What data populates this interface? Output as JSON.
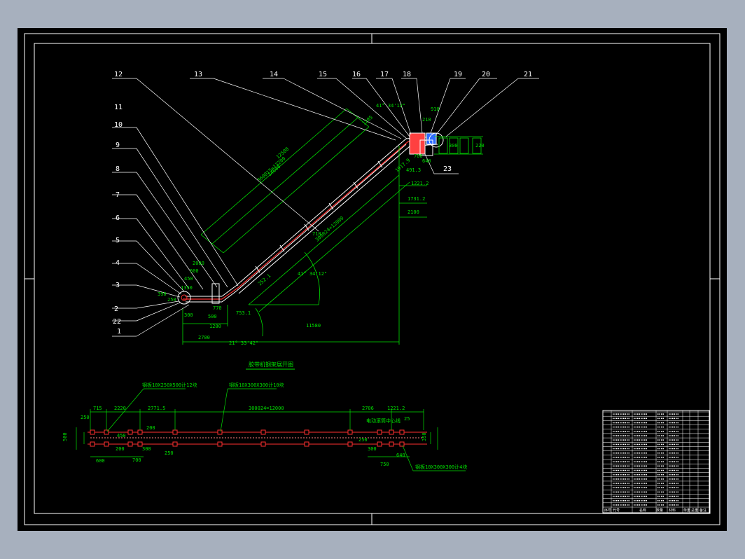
{
  "colors": {
    "background": "#a7b0be",
    "canvas": "#000000",
    "border": "#ffffff",
    "dimension": "#00e000",
    "leader": "#ffffff",
    "part": "#ff3030",
    "part_fill": "#ff4040",
    "blue": "#2f6cff"
  },
  "balloons": [
    "1",
    "2",
    "22",
    "3",
    "4",
    "5",
    "6",
    "7",
    "8",
    "9",
    "10",
    "11",
    "12",
    "13",
    "14",
    "15",
    "16",
    "17",
    "18",
    "19",
    "20",
    "21",
    "23"
  ],
  "elevation_dims": {
    "d2700": "2700",
    "d1280": "1280",
    "d300": "300",
    "d500": "500",
    "d770": "770",
    "d753": "753.1",
    "d11580": "11580",
    "d2100": "2100",
    "d1221": "1221.2",
    "d1731": "1731.2",
    "d491": "491.3",
    "d450": "450",
    "d600": "600",
    "d250": "250",
    "d390": "390",
    "d1350": "1350",
    "d2000": "2000",
    "d12500": "12500",
    "d300024": "300024=12000",
    "d360015": "360015=13200",
    "d710": "710",
    "d252": "252.1",
    "d1917": "1917.9",
    "d14600": "14600",
    "d1285": "1285",
    "angle_a": "41° 34'12\"",
    "angle_b": "21° 33'42\"",
    "angle_c": "41° 34'12\"",
    "d700": "700",
    "d640": "640",
    "d910": "910",
    "d210": "210",
    "d300b": "300",
    "d220": "220"
  },
  "plan_title": "胶带机钢架展开图",
  "plan_dims": {
    "p715": "715",
    "p2220": "2220",
    "p2771": "2771.5",
    "p300024": "300024=12000",
    "p2706": "2706",
    "p1221": "1221.2",
    "p250": "250",
    "p450": "450",
    "p200": "200",
    "p300": "300",
    "p200b": "200",
    "p700": "700",
    "p250b": "250",
    "p600": "600",
    "p500": "500",
    "p300b": "300",
    "p750": "750",
    "p640": "640",
    "p250c": "250",
    "p350": "350",
    "p25": "25"
  },
  "plan_notes": {
    "n1": "钢板10X250X500计12块",
    "n2": "钢板10X300X300计10块",
    "n3": "电动滚筒中心线",
    "n4": "钢板10X300X300计4块"
  },
  "title_block": {
    "rows": 22,
    "footer": [
      "序号",
      "代号",
      "名称",
      "数量",
      "材料",
      "单重",
      "总重",
      "备注"
    ]
  }
}
